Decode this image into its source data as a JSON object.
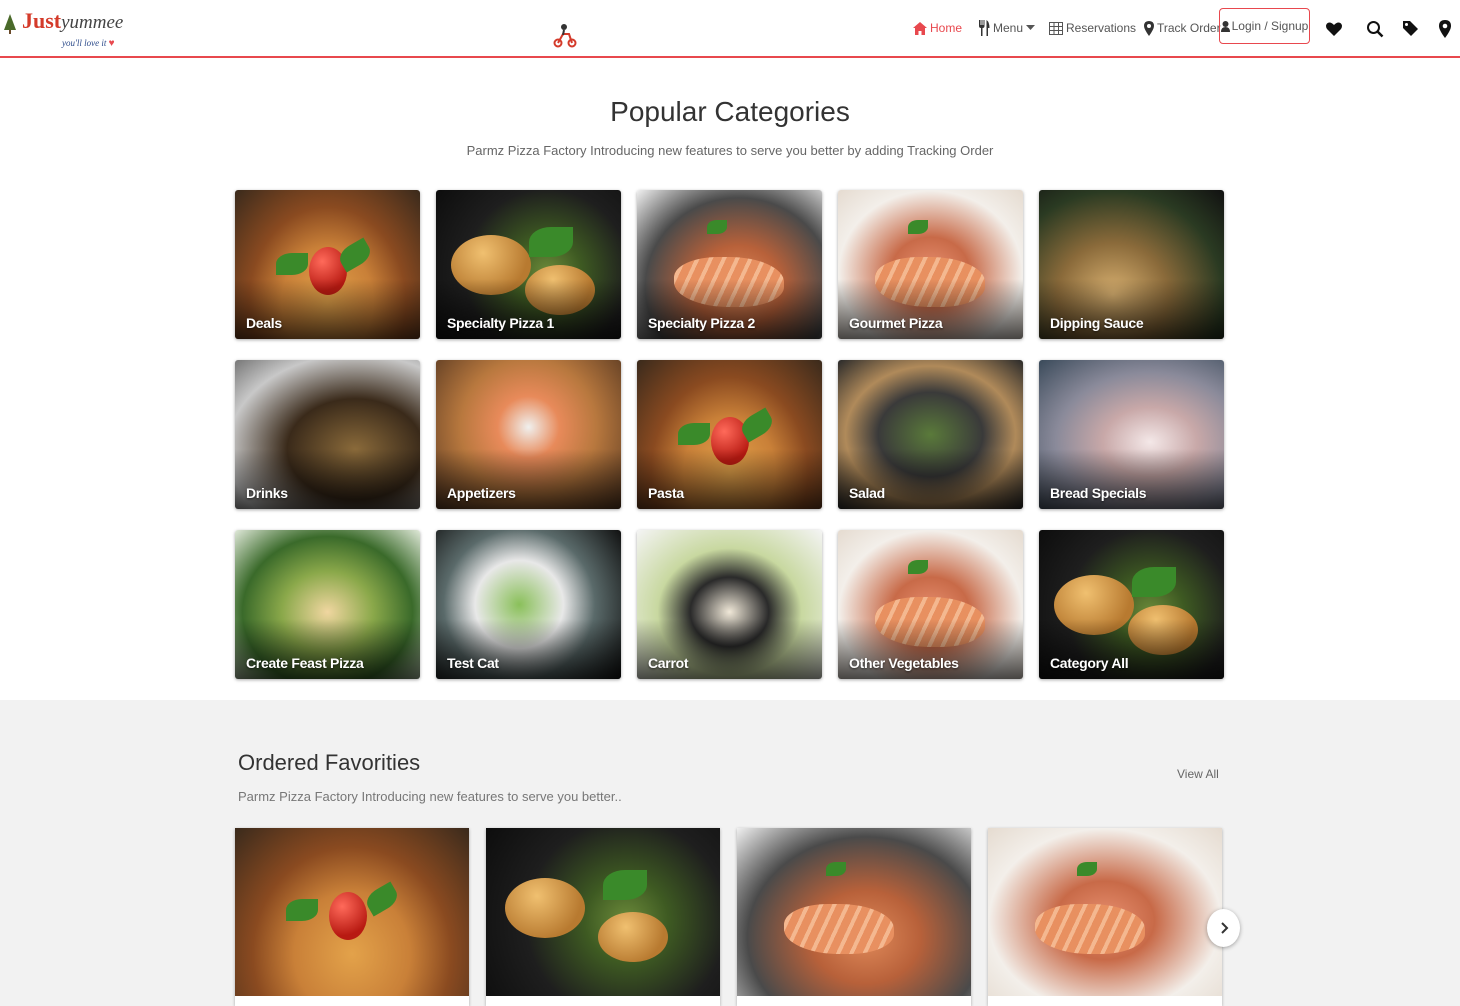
{
  "brand": {
    "name_part1": "Just",
    "name_part2": "yummee",
    "tagline": "you'll love it",
    "tagline_heart": "♥"
  },
  "nav": {
    "home": "Home",
    "menu": "Menu",
    "reservations": "Reservations",
    "track_order": "Track Order",
    "login": "Login / Signup"
  },
  "header_icons": [
    "heart-icon",
    "search-icon",
    "tags-icon",
    "map-pin-icon"
  ],
  "popular": {
    "title": "Popular Categories",
    "subtitle": "Parmz Pizza Factory Introducing new features to serve you better by adding Tracking Order",
    "categories": [
      {
        "label": "Deals",
        "image": "pizza"
      },
      {
        "label": "Specialty Pizza 1",
        "image": "burger"
      },
      {
        "label": "Specialty Pizza 2",
        "image": "salmon"
      },
      {
        "label": "Gourmet Pizza",
        "image": "gourmet"
      },
      {
        "label": "Dipping Sauce",
        "image": "dip"
      },
      {
        "label": "Drinks",
        "image": "drinks"
      },
      {
        "label": "Appetizers",
        "image": "appet"
      },
      {
        "label": "Pasta",
        "image": "pizza"
      },
      {
        "label": "Salad",
        "image": "salad"
      },
      {
        "label": "Bread Specials",
        "image": "bread"
      },
      {
        "label": "Create Feast Pizza",
        "image": "tacos"
      },
      {
        "label": "Test Cat",
        "image": "testcat"
      },
      {
        "label": "Carrot",
        "image": "carrot"
      },
      {
        "label": "Other Vegetables",
        "image": "gourmet"
      },
      {
        "label": "Category All",
        "image": "burger"
      }
    ]
  },
  "favorites": {
    "title": "Ordered Favorities",
    "subtitle": "Parmz Pizza Factory Introducing new features to serve you better..",
    "view_all": "View All",
    "items": [
      "pizza",
      "burger",
      "salmon",
      "gourmet"
    ]
  },
  "colors": {
    "accent": "#e8484e",
    "band": "#f2f2f2"
  }
}
